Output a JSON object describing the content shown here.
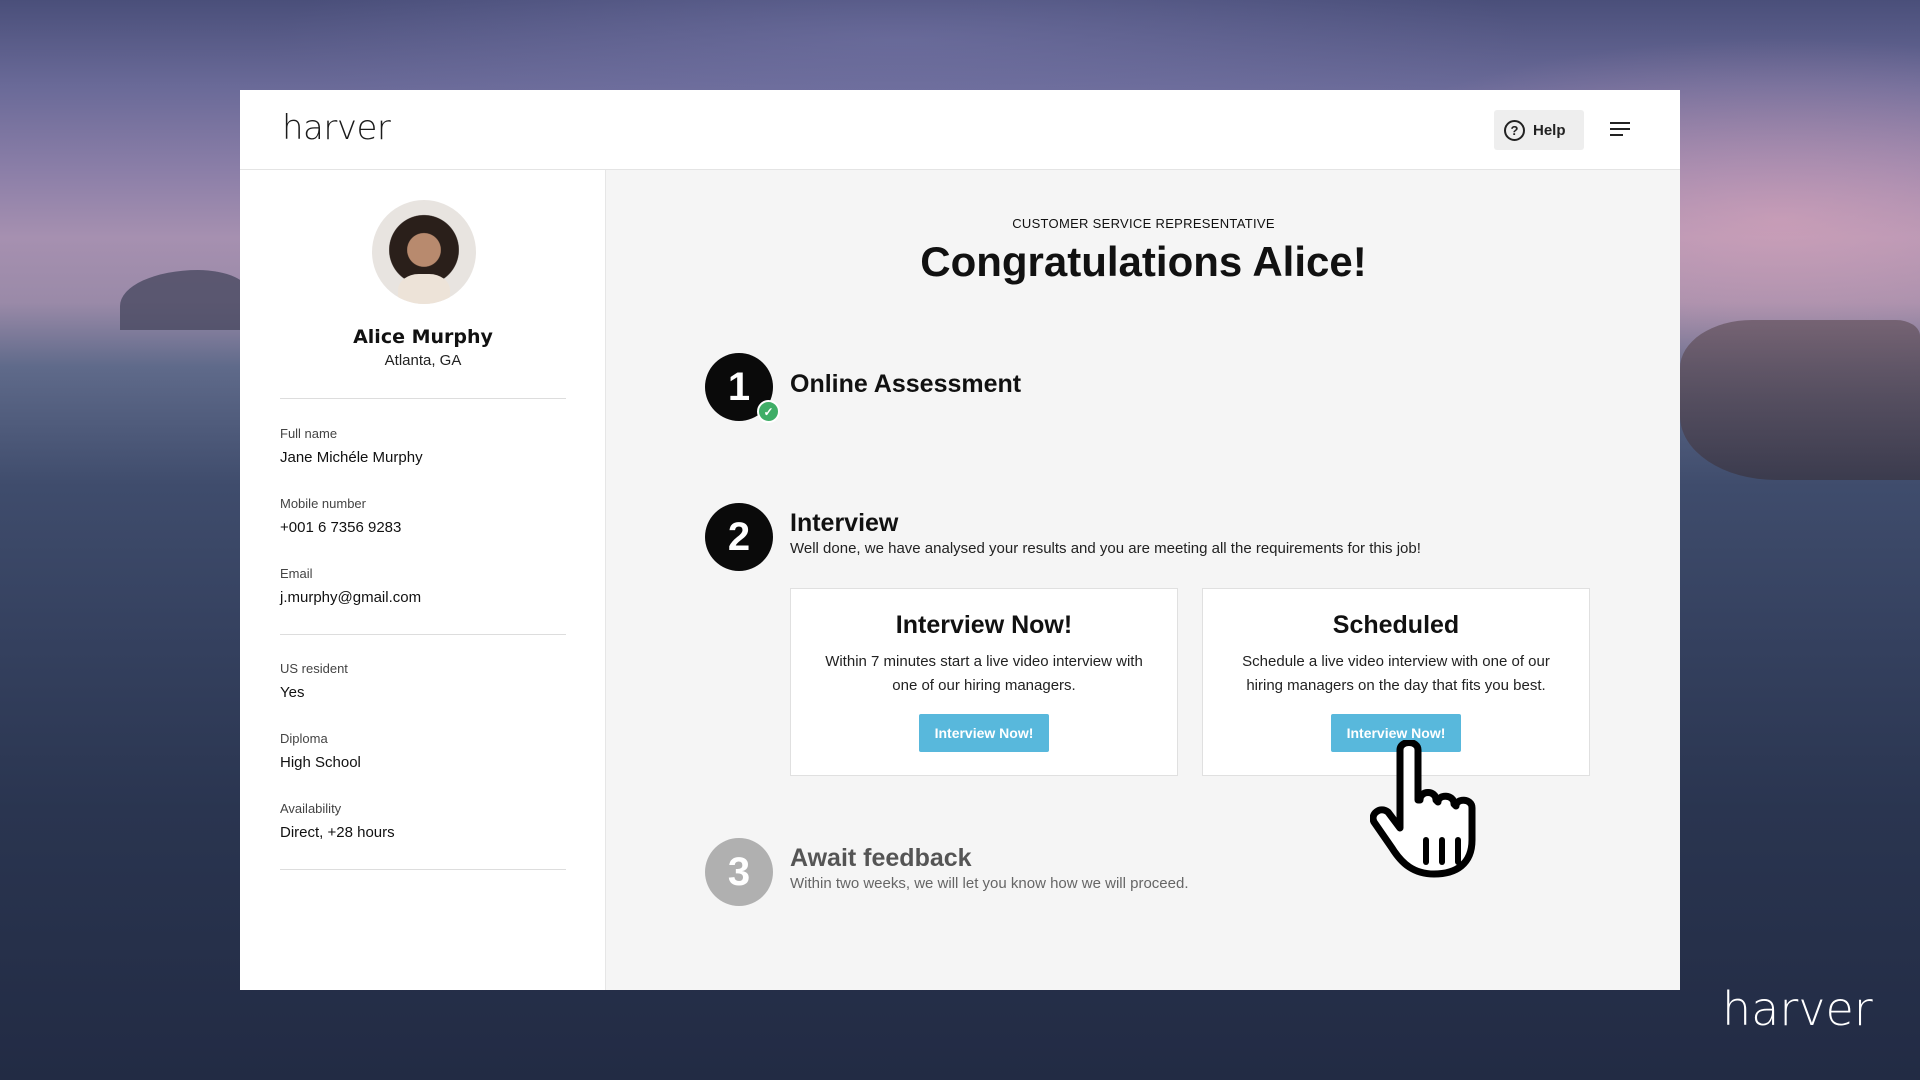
{
  "header": {
    "logo": "harver",
    "help_label": "Help"
  },
  "profile": {
    "name": "Alice Murphy",
    "city": "Atlanta, GA",
    "fields": [
      {
        "label": "Full name",
        "value": "Jane Michéle Murphy"
      },
      {
        "label": "Mobile number",
        "value": "+001 6 7356 9283"
      },
      {
        "label": "Email",
        "value": "j.murphy@gmail.com"
      },
      {
        "label": "US resident",
        "value": "Yes"
      },
      {
        "label": "Diploma",
        "value": "High School"
      },
      {
        "label": "Availability",
        "value": "Direct, +28 hours"
      }
    ]
  },
  "main": {
    "job_title": "CUSTOMER SERVICE REPRESENTATIVE",
    "congrats": "Congratulations Alice!",
    "steps": [
      {
        "number": "1",
        "title": "Online Assessment",
        "status": "completed"
      },
      {
        "number": "2",
        "title": "Interview",
        "description": "Well done, we have analysed your results and you are meeting all the requirements for this job!"
      },
      {
        "number": "3",
        "title": "Await feedback",
        "description": "Within two weeks, we will let you know how we will proceed."
      }
    ],
    "cards": [
      {
        "title": "Interview Now!",
        "text": "Within 7 minutes start a live video interview with one of our hiring managers.",
        "button": "Interview Now!"
      },
      {
        "title": "Scheduled",
        "text": "Schedule a live video interview with one of our hiring managers on the day that fits you best.",
        "button": "Interview Now!"
      }
    ]
  },
  "footer_brand": "harver",
  "colors": {
    "accent": "#58b8dc",
    "success": "#3fae67",
    "step_dark": "#0a0a0a",
    "step_pending": "#b0b0b0"
  }
}
